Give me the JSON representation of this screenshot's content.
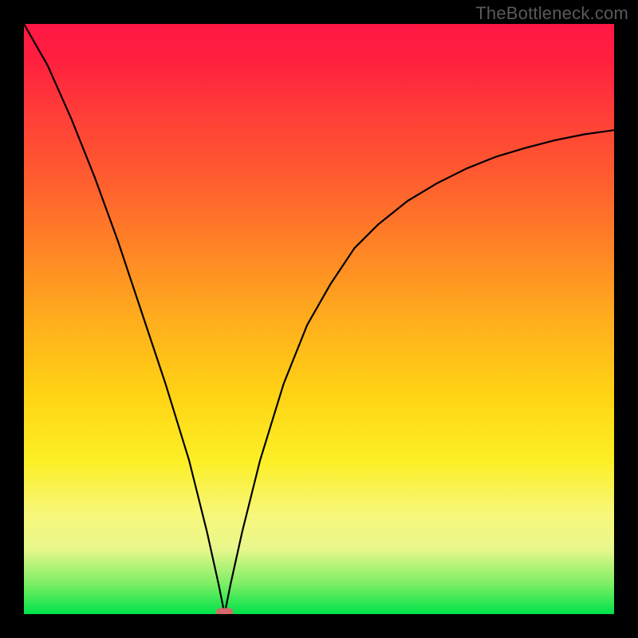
{
  "watermark": "TheBottleneck.com",
  "colors": {
    "frame": "#000000",
    "curve": "#000000",
    "marker": "#d46a6a",
    "gradient_top": "#ff1744",
    "gradient_bottom": "#00e24a"
  },
  "chart_data": {
    "type": "line",
    "title": "",
    "xlabel": "",
    "ylabel": "",
    "xlim": [
      0,
      100
    ],
    "ylim": [
      0,
      100
    ],
    "grid": false,
    "legend": false,
    "annotations": [
      {
        "name": "nadir-marker",
        "x": 34,
        "y": 0
      }
    ],
    "series": [
      {
        "name": "bottleneck-curve",
        "x": [
          0,
          4,
          8,
          12,
          16,
          20,
          24,
          28,
          31,
          33,
          34,
          35,
          37,
          40,
          44,
          48,
          52,
          56,
          60,
          65,
          70,
          75,
          80,
          85,
          90,
          95,
          100
        ],
        "values": [
          100,
          93,
          84,
          74,
          63,
          51,
          39,
          26,
          14,
          5,
          0,
          5,
          14,
          26,
          39,
          49,
          56,
          62,
          66,
          70,
          73,
          75.5,
          77.5,
          79,
          80.3,
          81.3,
          82
        ]
      }
    ]
  }
}
